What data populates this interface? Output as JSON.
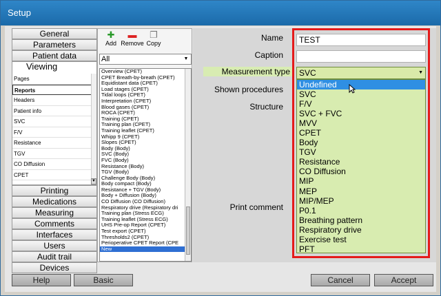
{
  "window": {
    "title": "Setup"
  },
  "nav": {
    "top_items": [
      "General",
      "Parameters",
      "Patient data"
    ],
    "active": "Viewing",
    "sub_items": [
      "Pages",
      "Reports",
      "Headers",
      "Patient info",
      "SVC",
      "F/V",
      "Resistance",
      "TGV",
      "CO Diffusion",
      "CPET"
    ],
    "sub_selected": "Reports",
    "bottom_items": [
      "Printing",
      "Medications",
      "Measuring",
      "Comments",
      "Interfaces",
      "Users",
      "Audit trail",
      "Devices"
    ]
  },
  "toolbar": {
    "add": "Add",
    "remove": "Remove",
    "copy": "Copy"
  },
  "filter": {
    "value": "All"
  },
  "reports": [
    "Overview (CPET)",
    "CPET Breath-by-breath (CPET)",
    "Equidistant data (CPET)",
    "Load stages (CPET)",
    "Tidal loops (CPET)",
    "Interpretation (CPET)",
    "Blood gases (CPET)",
    "ROCA (CPET)",
    "Training (CPET)",
    "Training plan (CPET)",
    "Training leaflet (CPET)",
    "Whipp 9 (CPET)",
    "Slopes (CPET)",
    "Body (Body)",
    "SVC (Body)",
    "FVC (Body)",
    "Resistance (Body)",
    "TGV (Body)",
    "Challenge Body (Body)",
    "Body compact (Body)",
    "Resistance + TGV (Body)",
    "Body + Diffusion (Body)",
    "CO Diffusion (CO Diffusion)",
    "Respiratory drive (Respiratory dri",
    "Training plan (Stress ECG)",
    "Training leaflet (Stress ECG)",
    "UHS Pre-op Report (CPET)",
    "Test export (CPET)",
    "Thresholds2 (CPET)",
    "Perioperative CPET Report (CPE",
    "New"
  ],
  "form": {
    "name_label": "Name",
    "name_value": "TEST",
    "caption_label": "Caption",
    "caption_value": "",
    "mtype_label": "Measurement type",
    "mtype_value": "SVC",
    "procedures_label": "Shown procedures",
    "structure_label": "Structure",
    "print_comment_label": "Print comment"
  },
  "mtype_options": [
    "Undefined",
    "SVC",
    "F/V",
    "SVC + FVC",
    "MVV",
    "CPET",
    "Body",
    "TGV",
    "Resistance",
    "CO Diffusion",
    "MIP",
    "MEP",
    "MIP/MEP",
    "P0.1",
    "Breathing pattern",
    "Respiratory drive",
    "Exercise test",
    "PFT"
  ],
  "mtype_highlighted": "Undefined",
  "buttons": {
    "help": "Help",
    "basic": "Basic",
    "cancel": "Cancel",
    "accept": "Accept"
  },
  "colors": {
    "titlebar": "#1b6aa9",
    "highlight_frame": "#e51a1a",
    "combo_bg": "#d8ecb0",
    "selection": "#2f8fe3"
  }
}
